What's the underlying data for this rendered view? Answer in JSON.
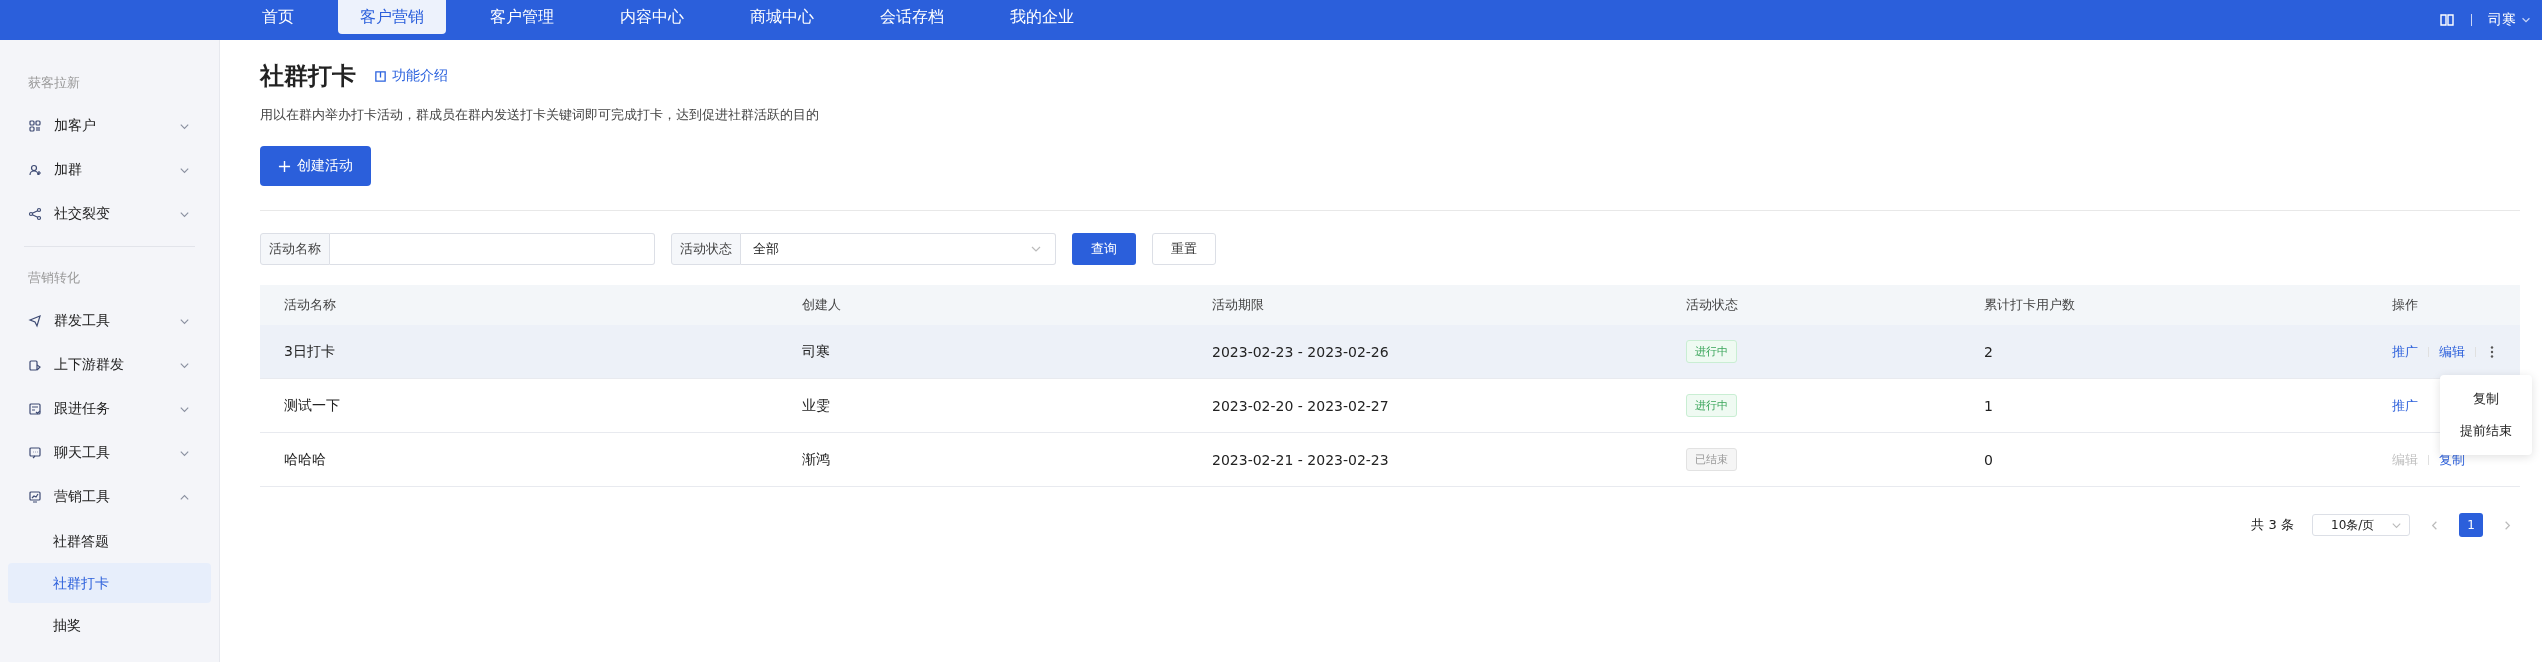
{
  "nav": {
    "tabs": [
      {
        "label": "首页",
        "selected": false
      },
      {
        "label": "客户营销",
        "selected": true
      },
      {
        "label": "客户管理",
        "selected": false
      },
      {
        "label": "内容中心",
        "selected": false
      },
      {
        "label": "商城中心",
        "selected": false
      },
      {
        "label": "会话存档",
        "selected": false
      },
      {
        "label": "我的企业",
        "selected": false
      }
    ],
    "user": "司寒"
  },
  "sidebar": {
    "sections": [
      {
        "title": "获客拉新",
        "items": [
          {
            "label": "加客户",
            "expanded": false
          },
          {
            "label": "加群",
            "expanded": false
          },
          {
            "label": "社交裂变",
            "expanded": false
          }
        ]
      },
      {
        "title": "营销转化",
        "items": [
          {
            "label": "群发工具",
            "expanded": false
          },
          {
            "label": "上下游群发",
            "expanded": false
          },
          {
            "label": "跟进任务",
            "expanded": false
          },
          {
            "label": "聊天工具",
            "expanded": false
          },
          {
            "label": "营销工具",
            "expanded": true,
            "children": [
              {
                "label": "社群答题",
                "selected": false
              },
              {
                "label": "社群打卡",
                "selected": true
              },
              {
                "label": "抽奖",
                "selected": false
              }
            ]
          }
        ]
      }
    ]
  },
  "page": {
    "title": "社群打卡",
    "intro_link": "功能介绍",
    "description": "用以在群内举办打卡活动，群成员在群内发送打卡关键词即可完成打卡，达到促进社群活跃的目的",
    "create_button": "创建活动"
  },
  "filters": {
    "name_label": "活动名称",
    "status_label": "活动状态",
    "status_value": "全部",
    "query_button": "查询",
    "reset_button": "重置"
  },
  "table": {
    "columns": [
      "活动名称",
      "创建人",
      "活动期限",
      "活动状态",
      "累计打卡用户数",
      "操作"
    ],
    "rows": [
      {
        "name": "3日打卡",
        "creator": "司寒",
        "period": "2023-02-23 - 2023-02-26",
        "status": {
          "label": "进行中",
          "kind": "active"
        },
        "count": "2",
        "highlighted": true,
        "actions": [
          {
            "label": "推广",
            "disabled": false
          },
          {
            "label": "编辑",
            "disabled": false
          }
        ],
        "more": true
      },
      {
        "name": "测试一下",
        "creator": "业雯",
        "period": "2023-02-20 - 2023-02-27",
        "status": {
          "label": "进行中",
          "kind": "active"
        },
        "count": "1",
        "highlighted": false,
        "actions": [
          {
            "label": "推广",
            "disabled": false
          }
        ],
        "more": false
      },
      {
        "name": "哈哈哈",
        "creator": "渐鸿",
        "period": "2023-02-21 - 2023-02-23",
        "status": {
          "label": "已结束",
          "kind": "ended"
        },
        "count": "0",
        "highlighted": false,
        "actions": [
          {
            "label": "编辑",
            "disabled": true
          },
          {
            "label": "复制",
            "disabled": false
          }
        ],
        "more": false
      }
    ]
  },
  "menu": {
    "items": [
      "复制",
      "提前结束"
    ]
  },
  "pagination": {
    "total": "共 3 条",
    "page_size": "10条/页",
    "pages": [
      {
        "label": "1",
        "selected": true
      }
    ]
  }
}
